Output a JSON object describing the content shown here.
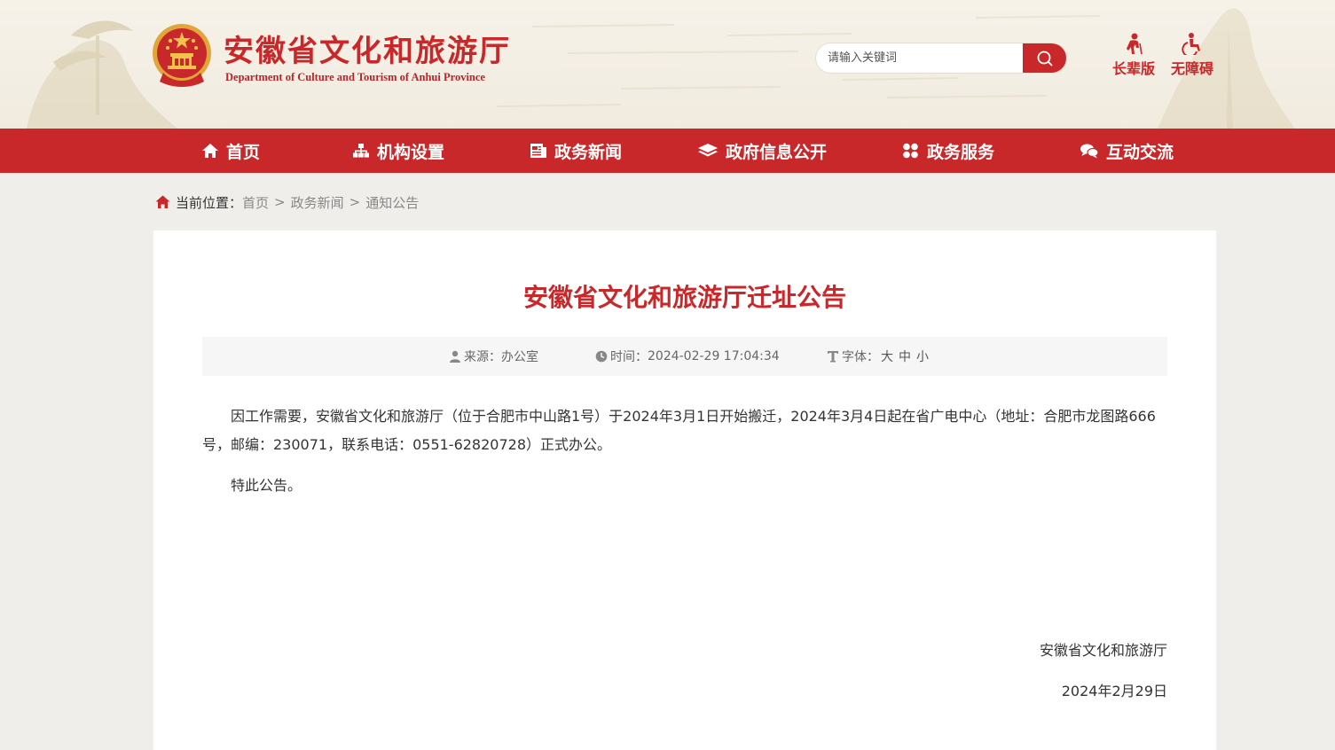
{
  "header": {
    "title": "安徽省文化和旅游厅",
    "subtitle": "Department of Culture and Tourism of Anhui Province",
    "search": {
      "placeholder": "请输入关键词"
    },
    "tools": [
      {
        "label": "长辈版",
        "icon": "elder-icon"
      },
      {
        "label": "无障碍",
        "icon": "accessibility-icon"
      }
    ]
  },
  "nav": {
    "items": [
      {
        "label": "首页",
        "icon": "home-icon"
      },
      {
        "label": "机构设置",
        "icon": "org-chart-icon"
      },
      {
        "label": "政务新闻",
        "icon": "news-icon"
      },
      {
        "label": "政府信息公开",
        "icon": "layers-icon"
      },
      {
        "label": "政务服务",
        "icon": "grid-icon"
      },
      {
        "label": "互动交流",
        "icon": "chat-icon"
      }
    ]
  },
  "breadcrumb": {
    "label": "当前位置：",
    "items": [
      "首页",
      "政务新闻",
      "通知公告"
    ],
    "separator": ">"
  },
  "article": {
    "title": "安徽省文化和旅游厅迁址公告",
    "meta": {
      "source_label": "来源：",
      "source": "办公室",
      "time_label": "时间：",
      "time": "2024-02-29 17:04:34",
      "font_label": "字体：",
      "font_sizes": [
        "大",
        "中",
        "小"
      ]
    },
    "paragraphs": [
      "因工作需要，安徽省文化和旅游厅（位于合肥市中山路1号）于2024年3月1日开始搬迁，2024年3月4日起在省广电中心（地址：合肥市龙图路666号，邮编：230071，联系电话：0551-62820728）正式办公。",
      "特此公告。"
    ],
    "signature": {
      "org": "安徽省文化和旅游厅",
      "date": "2024年2月29日"
    }
  },
  "colors": {
    "brand_red": "#c8282a",
    "page_bg": "#efeeea",
    "meta_bg": "#f6f6f6"
  }
}
